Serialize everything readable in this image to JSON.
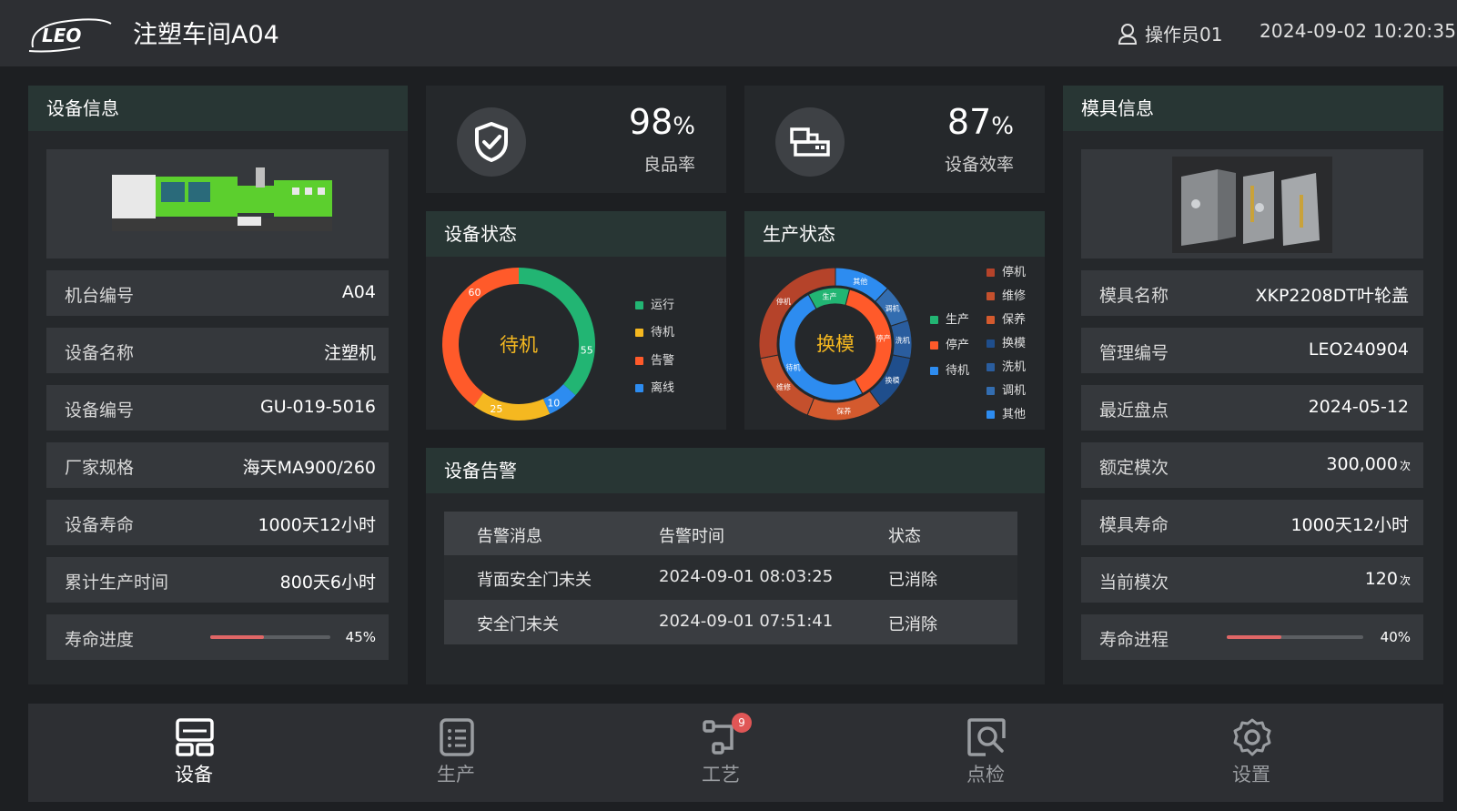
{
  "header": {
    "logo_text": "LEO",
    "title": "注塑车间A04",
    "user": "操作员01",
    "datetime": "2024-09-02  10:20:35"
  },
  "device_info": {
    "title": "设备信息",
    "rows": [
      {
        "label": "机台编号",
        "value": "A04"
      },
      {
        "label": "设备名称",
        "value": "注塑机"
      },
      {
        "label": "设备编号",
        "value": "GU-019-5016"
      },
      {
        "label": "厂家规格",
        "value": "海天MA900/260"
      },
      {
        "label": "设备寿命",
        "value": "1000天12小时"
      },
      {
        "label": "累计生产时间",
        "value": "800天6小时"
      }
    ],
    "life_progress": {
      "label": "寿命进度",
      "percent": 45,
      "percent_text": "45%"
    }
  },
  "kpis": [
    {
      "value": "98",
      "unit": "%",
      "label": "良品率",
      "icon": "shield-check-icon"
    },
    {
      "value": "87",
      "unit": "%",
      "label": "设备效率",
      "icon": "machine-icon"
    }
  ],
  "device_status": {
    "title": "设备状态",
    "center_label": "待机",
    "legend": [
      {
        "name": "运行",
        "color": "#22b573"
      },
      {
        "name": "待机",
        "color": "#f5b820"
      },
      {
        "name": "告警",
        "color": "#ff5a2a"
      },
      {
        "name": "离线",
        "color": "#2d8cf0"
      }
    ]
  },
  "production_status": {
    "title": "生产状态",
    "center_label": "换模",
    "inner_legend": [
      {
        "name": "生产",
        "color": "#22b573"
      },
      {
        "name": "停产",
        "color": "#ff5a2a"
      },
      {
        "name": "待机",
        "color": "#2d8cf0"
      }
    ],
    "outer_legend": [
      {
        "name": "停机",
        "color": "#b5432a"
      },
      {
        "name": "维修",
        "color": "#c4502d"
      },
      {
        "name": "保养",
        "color": "#d45a2e"
      },
      {
        "name": "换模",
        "color": "#1f4e8c"
      },
      {
        "name": "洗机",
        "color": "#2a5d9e"
      },
      {
        "name": "调机",
        "color": "#336db0"
      },
      {
        "name": "其他",
        "color": "#2d8cf0"
      }
    ]
  },
  "chart_data": [
    {
      "type": "pie",
      "title": "设备状态",
      "categories": [
        "运行",
        "离线",
        "待机",
        "告警"
      ],
      "values": [
        55,
        10,
        25,
        60
      ]
    },
    {
      "type": "pie",
      "title": "生产状态",
      "series": [
        {
          "categories": [
            "生产",
            "停产",
            "待机"
          ],
          "labels": [
            "生产",
            "停产",
            "待机"
          ]
        },
        {
          "categories": [
            "其他",
            "调机",
            "洗机",
            "换模",
            "保养",
            "维修",
            "停机"
          ],
          "labels": [
            "其他",
            "调机",
            "洗机",
            "换模",
            "保养",
            "维修",
            "停机"
          ]
        }
      ]
    }
  ],
  "alarms": {
    "title": "设备告警",
    "columns": [
      "告警消息",
      "告警时间",
      "状态"
    ],
    "rows": [
      [
        "背面安全门未关",
        "2024-09-01 08:03:25",
        "已消除"
      ],
      [
        "安全门未关",
        "2024-09-01 07:51:41",
        "已消除"
      ]
    ]
  },
  "mold_info": {
    "title": "模具信息",
    "rows": [
      {
        "label": "模具名称",
        "value": "XKP2208DT叶轮盖",
        "unit": ""
      },
      {
        "label": "管理编号",
        "value": "LEO240904",
        "unit": ""
      },
      {
        "label": "最近盘点",
        "value": "2024-05-12",
        "unit": ""
      },
      {
        "label": "额定模次",
        "value": "300,000",
        "unit": "次"
      },
      {
        "label": "模具寿命",
        "value": "1000天12小时",
        "unit": ""
      },
      {
        "label": "当前模次",
        "value": "120",
        "unit": "次"
      }
    ],
    "life_progress": {
      "label": "寿命进程",
      "percent": 40,
      "percent_text": "40%"
    }
  },
  "nav": [
    {
      "label": "设备",
      "icon": "device-icon",
      "active": true
    },
    {
      "label": "生产",
      "icon": "production-icon",
      "active": false
    },
    {
      "label": "工艺",
      "icon": "process-icon",
      "active": false,
      "badge": "9"
    },
    {
      "label": "点检",
      "icon": "inspection-icon",
      "active": false
    },
    {
      "label": "设置",
      "icon": "settings-icon",
      "active": false
    }
  ]
}
